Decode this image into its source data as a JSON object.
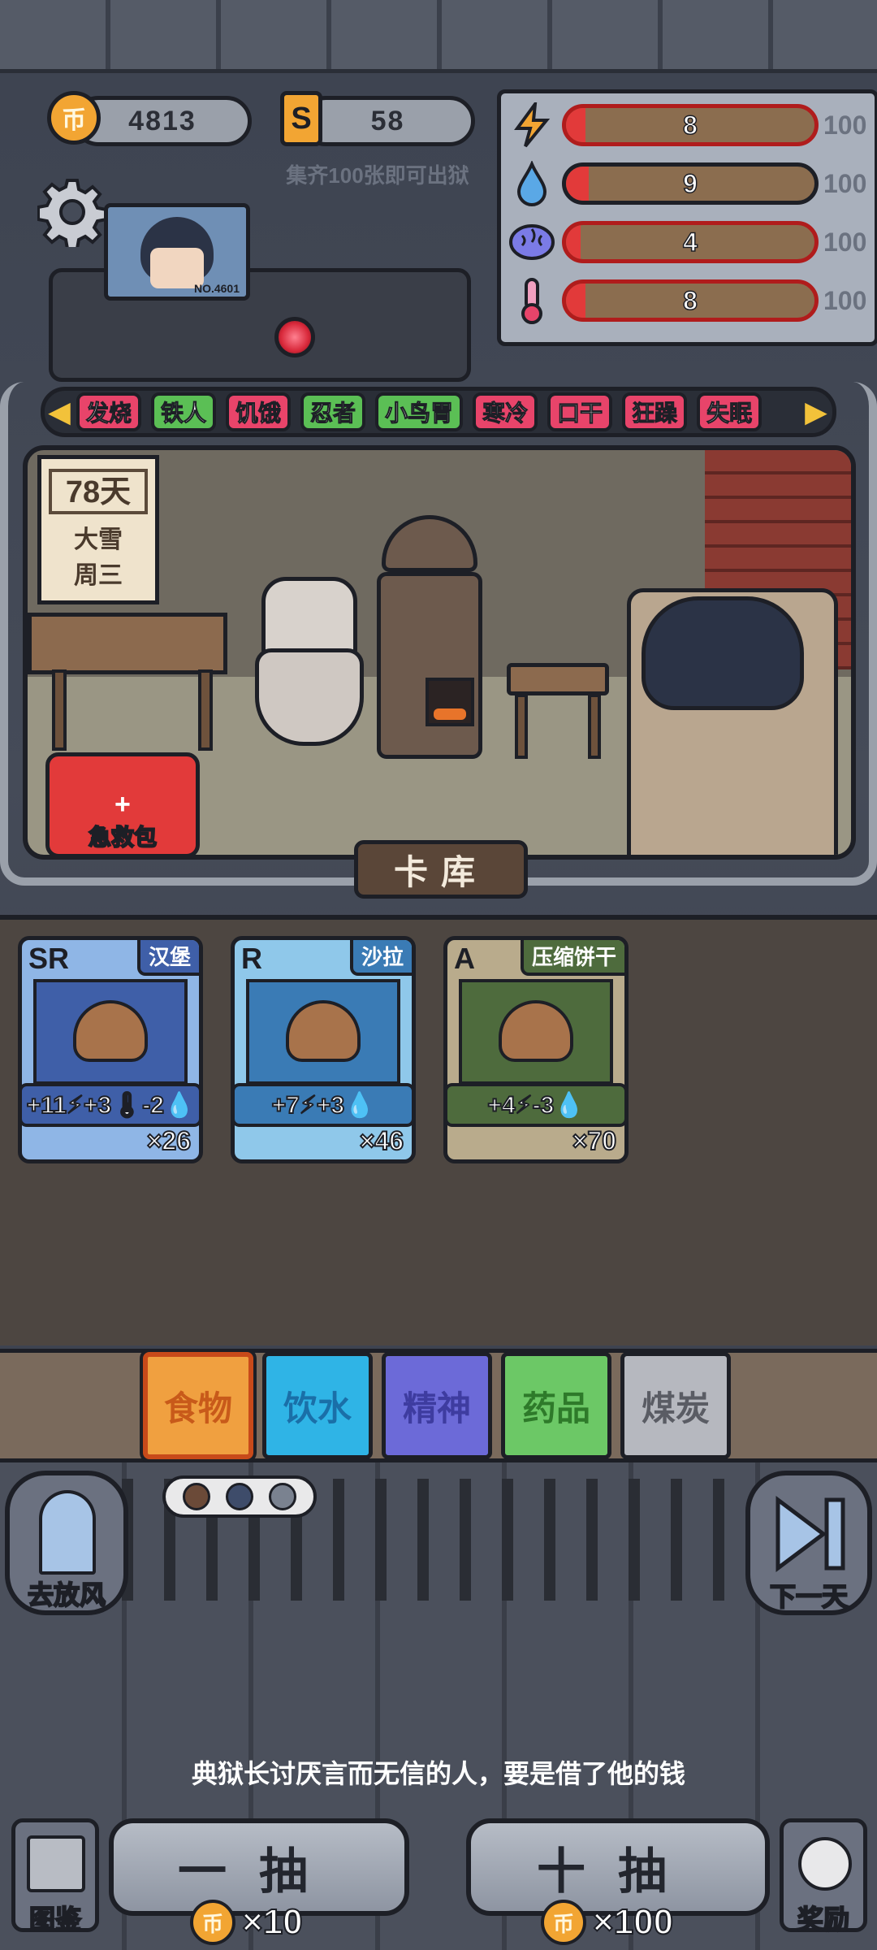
{
  "resources": {
    "coins": "4813",
    "tickets": "58",
    "hint": "集齐100张即可出狱",
    "coin_icon": "币",
    "ticket_icon": "S"
  },
  "robot": {
    "badge": "NO.4601"
  },
  "stats": [
    {
      "icon": "lightning-icon",
      "value": "8",
      "max": "100",
      "fill": 0.08,
      "color": "#e23a3a"
    },
    {
      "icon": "water-drop-icon",
      "value": "9",
      "max": "100",
      "fill": 0.09,
      "color": "#e23a3a"
    },
    {
      "icon": "brain-icon",
      "value": "4",
      "max": "100",
      "fill": 0.04,
      "color": "#e23a3a"
    },
    {
      "icon": "thermometer-icon",
      "value": "8",
      "max": "100",
      "fill": 0.08,
      "color": "#e23a3a"
    }
  ],
  "status_tags": [
    {
      "label": "发烧",
      "color": "#e8446a"
    },
    {
      "label": "铁人",
      "color": "#5bbf55"
    },
    {
      "label": "饥饿",
      "color": "#e8446a"
    },
    {
      "label": "忍者",
      "color": "#5bbf55"
    },
    {
      "label": "小鸟胃",
      "color": "#5bbf55"
    },
    {
      "label": "寒冷",
      "color": "#e8446a"
    },
    {
      "label": "口干",
      "color": "#e8446a"
    },
    {
      "label": "狂躁",
      "color": "#e8446a"
    },
    {
      "label": "失眠",
      "color": "#e8446a"
    }
  ],
  "calendar": {
    "day": "78天",
    "weather": "大雪",
    "weekday": "周三"
  },
  "first_aid": {
    "label": "急救包"
  },
  "card_library": {
    "label": "卡库"
  },
  "cards": [
    {
      "rarity": "SR",
      "name": "汉堡",
      "effect": "+11⚡+3🌡-2💧",
      "count": "×26",
      "bg": "#8fb6e6",
      "frame": "#3f5fa8"
    },
    {
      "rarity": "R",
      "name": "沙拉",
      "effect": "+7⚡+3💧",
      "count": "×46",
      "bg": "#8fc8ea",
      "frame": "#3a7bb5"
    },
    {
      "rarity": "A",
      "name": "压缩饼干",
      "effect": "+4⚡-3💧",
      "count": "×70",
      "bg": "#b9ab8c",
      "frame": "#4e6b3d"
    }
  ],
  "categories": [
    {
      "label": "食物",
      "bg": "#f0a040",
      "fg": "#c85a1a"
    },
    {
      "label": "饮水",
      "bg": "#2fb4e6",
      "fg": "#1a6fa8"
    },
    {
      "label": "精神",
      "bg": "#6c6ad8",
      "fg": "#3e3ca0"
    },
    {
      "label": "药品",
      "bg": "#6cc866",
      "fg": "#2e7a2a"
    },
    {
      "label": "煤炭",
      "bg": "#b6b8bf",
      "fg": "#5a5c64"
    }
  ],
  "actions": {
    "go_out": "去放风",
    "next_day": "下一天",
    "catalog": "图鉴",
    "reward": "奖励"
  },
  "dialogue": "典狱长讨厌言而无信的人，要是借了他的钱",
  "draw": {
    "one_label": "一抽",
    "one_cost": "×10",
    "ten_label": "十抽",
    "ten_cost": "×100"
  }
}
